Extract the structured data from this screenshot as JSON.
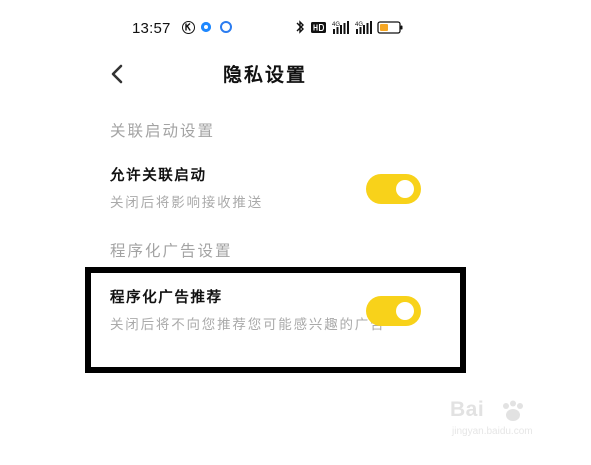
{
  "status_bar": {
    "time": "13:57",
    "icons": [
      "k-circle-icon",
      "blue-dot-icon",
      "q-app-icon",
      "bluetooth-icon",
      "hd-icon",
      "signal-4g-icon",
      "signal-4g-icon",
      "battery-icon"
    ]
  },
  "header": {
    "back_icon": "chevron-left-icon",
    "title": "隐私设置"
  },
  "sections": [
    {
      "title": "关联启动设置",
      "items": [
        {
          "label": "允许关联启动",
          "description": "关闭后将影响接收推送",
          "toggle_on": true
        }
      ]
    },
    {
      "title": "程序化广告设置",
      "items": [
        {
          "label": "程序化广告推荐",
          "description": "关闭后将不向您推荐您可能感兴趣的广告",
          "toggle_on": true
        }
      ]
    }
  ],
  "colors": {
    "toggle_on": "#f8d21a",
    "section_title": "#a3a3a3",
    "description": "#aaaaaa",
    "highlight_frame": "#000000"
  },
  "watermark": {
    "logo": "Bai",
    "url": "jingyan.baidu.com"
  }
}
